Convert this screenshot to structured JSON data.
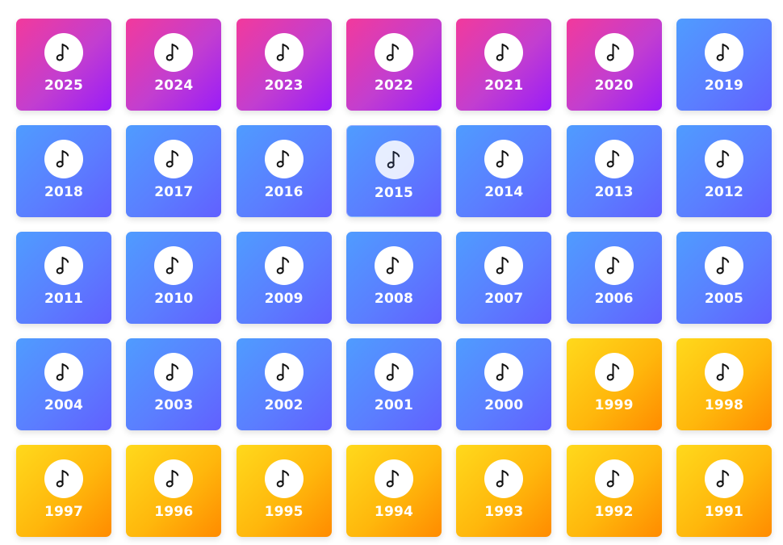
{
  "tiles": [
    {
      "year": "2025",
      "theme": "pink"
    },
    {
      "year": "2024",
      "theme": "pink"
    },
    {
      "year": "2023",
      "theme": "pink"
    },
    {
      "year": "2022",
      "theme": "pink"
    },
    {
      "year": "2021",
      "theme": "pink"
    },
    {
      "year": "2020",
      "theme": "pink"
    },
    {
      "year": "2019",
      "theme": "blue"
    },
    {
      "year": "2018",
      "theme": "blue"
    },
    {
      "year": "2017",
      "theme": "blue"
    },
    {
      "year": "2016",
      "theme": "blue"
    },
    {
      "year": "2015",
      "theme": "blue",
      "state": "hover"
    },
    {
      "year": "2014",
      "theme": "blue"
    },
    {
      "year": "2013",
      "theme": "blue"
    },
    {
      "year": "2012",
      "theme": "blue"
    },
    {
      "year": "2011",
      "theme": "blue"
    },
    {
      "year": "2010",
      "theme": "blue"
    },
    {
      "year": "2009",
      "theme": "blue"
    },
    {
      "year": "2008",
      "theme": "blue"
    },
    {
      "year": "2007",
      "theme": "blue"
    },
    {
      "year": "2006",
      "theme": "blue"
    },
    {
      "year": "2005",
      "theme": "blue"
    },
    {
      "year": "2004",
      "theme": "blue"
    },
    {
      "year": "2003",
      "theme": "blue"
    },
    {
      "year": "2002",
      "theme": "blue"
    },
    {
      "year": "2001",
      "theme": "blue"
    },
    {
      "year": "2000",
      "theme": "blue"
    },
    {
      "year": "1999",
      "theme": "gold"
    },
    {
      "year": "1998",
      "theme": "gold"
    },
    {
      "year": "1997",
      "theme": "gold"
    },
    {
      "year": "1996",
      "theme": "gold"
    },
    {
      "year": "1995",
      "theme": "gold"
    },
    {
      "year": "1994",
      "theme": "gold"
    },
    {
      "year": "1993",
      "theme": "gold"
    },
    {
      "year": "1992",
      "theme": "gold"
    },
    {
      "year": "1991",
      "theme": "gold"
    }
  ],
  "icon": "music-note-icon",
  "colors": {
    "pink_start": "#f23a9c",
    "pink_end": "#9a1cf8",
    "blue_start": "#4f9cff",
    "blue_end": "#6160ff",
    "gold_start": "#ffd91c",
    "gold_end": "#ff8b00",
    "label": "#ffffff"
  }
}
